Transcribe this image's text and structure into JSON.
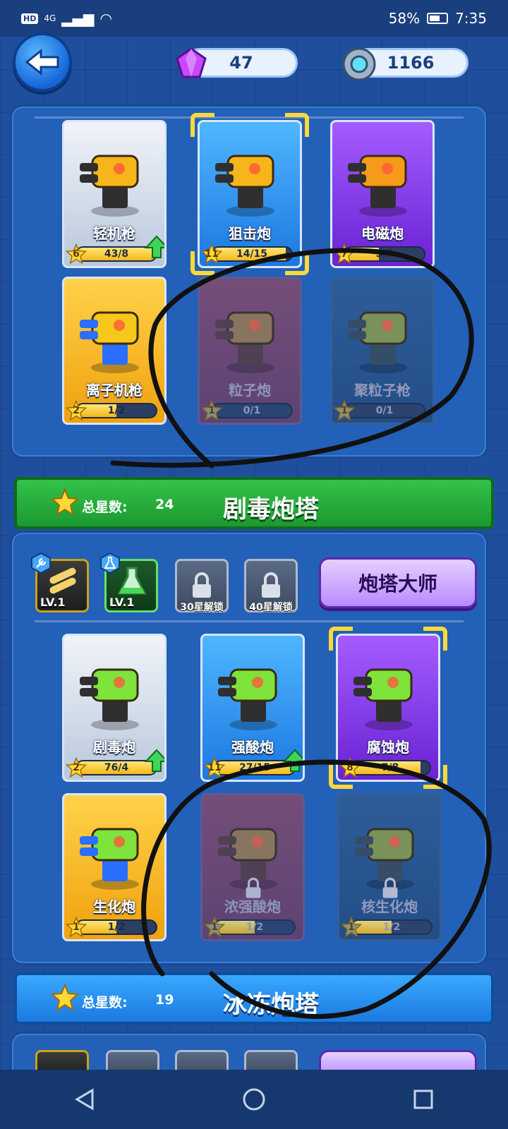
{
  "status": {
    "signal": "4G",
    "hd": "HD",
    "battery": "58%",
    "time": "7:35"
  },
  "currency": {
    "gems": "47",
    "coins": "1166"
  },
  "section1": {
    "cards": [
      {
        "name": "轻机枪",
        "level": "6",
        "progress": "43/8",
        "fill": 1.0,
        "upgrade": true,
        "style": "gray"
      },
      {
        "name": "狙击炮",
        "level": "11",
        "progress": "14/15",
        "fill": 0.93,
        "upgrade": false,
        "style": "blue",
        "selected": true
      },
      {
        "name": "电磁炮",
        "level": "7",
        "progress": "3/7",
        "fill": 0.43,
        "upgrade": false,
        "style": "purple"
      },
      {
        "name": "离子机枪",
        "level": "2",
        "progress": "1/2",
        "fill": 0.5,
        "upgrade": false,
        "style": "gold"
      },
      {
        "name": "粒子炮",
        "level": "1",
        "progress": "0/1",
        "fill": 0.0,
        "upgrade": false,
        "style": "locked-red"
      },
      {
        "name": "聚粒子枪",
        "level": "1",
        "progress": "0/1",
        "fill": 0.0,
        "upgrade": false,
        "style": "locked-blue"
      }
    ]
  },
  "banner_poison": {
    "label": "总星数:",
    "count": "24",
    "title": "剧毒炮塔"
  },
  "poison_skills": {
    "skill1_level": "LV.1",
    "skill2_level": "LV.1",
    "lock1_caption": "30星解锁",
    "lock2_caption": "40星解锁",
    "master_button": "炮塔大师"
  },
  "section2": {
    "cards": [
      {
        "name": "剧毒炮",
        "level": "2",
        "progress": "76/4",
        "fill": 1.0,
        "upgrade": true,
        "style": "gray"
      },
      {
        "name": "强酸炮",
        "level": "11",
        "progress": "27/15",
        "fill": 1.0,
        "upgrade": true,
        "style": "blue"
      },
      {
        "name": "腐蚀炮",
        "level": "8",
        "progress": "7/8",
        "fill": 0.875,
        "upgrade": false,
        "style": "purple",
        "selected": true
      },
      {
        "name": "生化炮",
        "level": "1",
        "progress": "1/2",
        "fill": 0.5,
        "upgrade": false,
        "style": "gold"
      },
      {
        "name": "浓强酸炮",
        "level": "1",
        "progress": "1/2",
        "fill": 0.5,
        "upgrade": false,
        "style": "locked-red",
        "locked": true
      },
      {
        "name": "核生化炮",
        "level": "1",
        "progress": "1/2",
        "fill": 0.5,
        "upgrade": false,
        "style": "locked-blue",
        "locked": true
      }
    ]
  },
  "banner_ice": {
    "label": "总星数:",
    "count": "19",
    "title": "冰冻炮塔"
  },
  "icons": {
    "back": "back-arrow-icon",
    "gem": "purple-gem-icon",
    "coin": "gear-coin-icon",
    "star": "star-icon",
    "lock": "lock-icon",
    "upgrade": "up-arrow-icon"
  },
  "colors": {
    "accent_green": "#1b9930",
    "accent_blue": "#1b7ae0",
    "gold": "#f4b818"
  }
}
